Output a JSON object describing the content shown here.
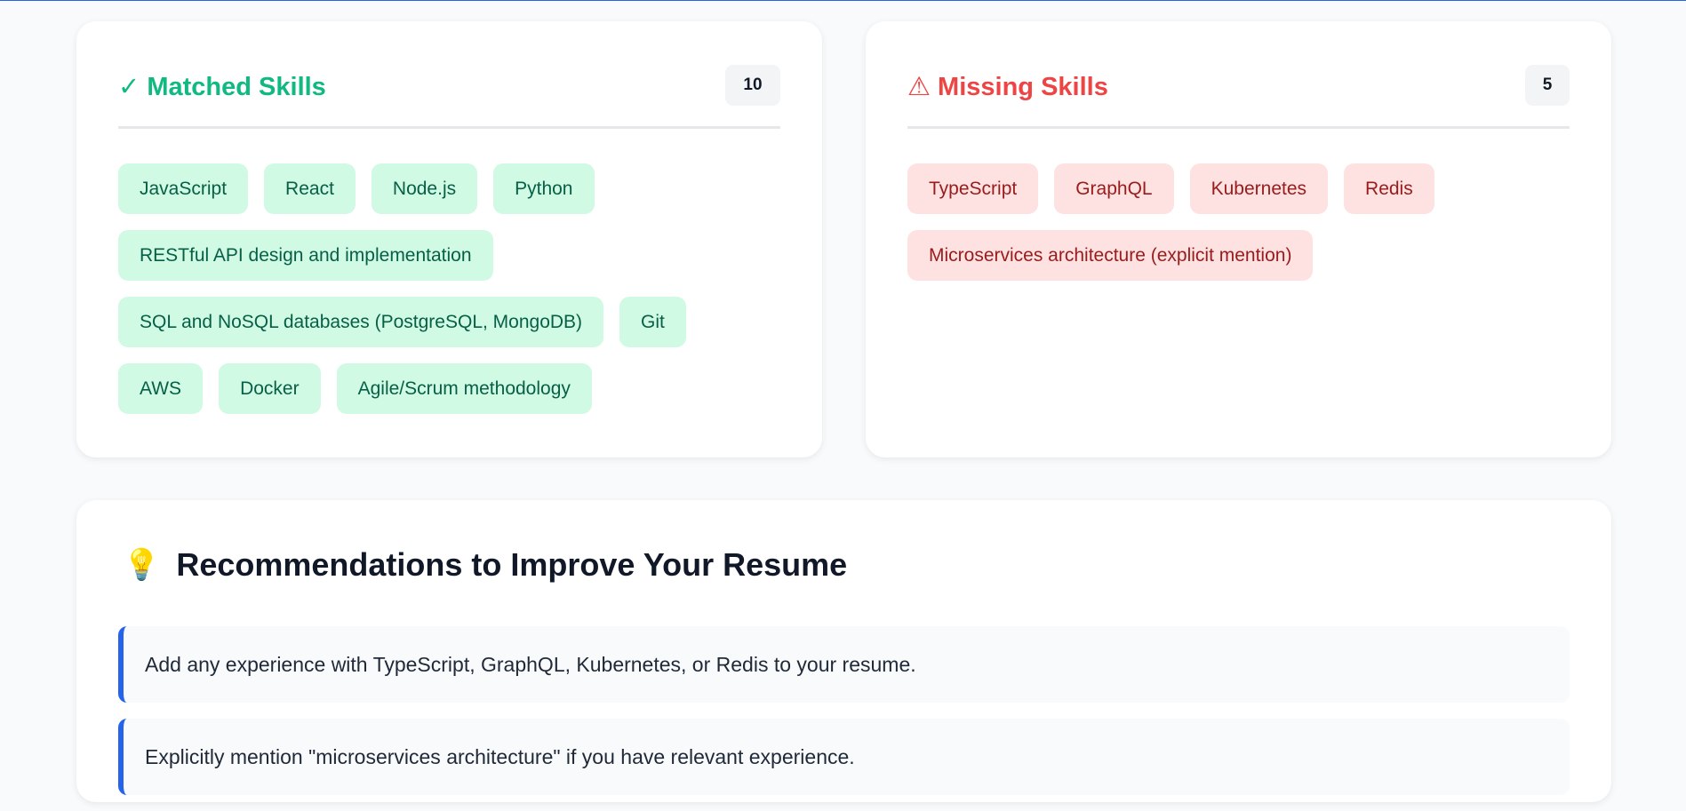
{
  "matched": {
    "title": "✓ Matched Skills",
    "count": "10",
    "skills": [
      "JavaScript",
      "React",
      "Node.js",
      "Python",
      "RESTful API design and implementation",
      "SQL and NoSQL databases (PostgreSQL, MongoDB)",
      "Git",
      "AWS",
      "Docker",
      "Agile/Scrum methodology"
    ],
    "color": "#10b981"
  },
  "missing": {
    "title": "⚠ Missing Skills",
    "count": "5",
    "skills": [
      "TypeScript",
      "GraphQL",
      "Kubernetes",
      "Redis",
      "Microservices architecture (explicit mention)"
    ],
    "color": "#ef4444"
  },
  "recommendations": {
    "icon": "lightbulb-icon",
    "icon_glyph": "💡",
    "title": "Recommendations to Improve Your Resume",
    "items": [
      "Add any experience with TypeScript, GraphQL, Kubernetes, or Redis to your resume.",
      "Explicitly mention \"microservices architecture\" if you have relevant experience."
    ],
    "accent": "#2563eb"
  }
}
